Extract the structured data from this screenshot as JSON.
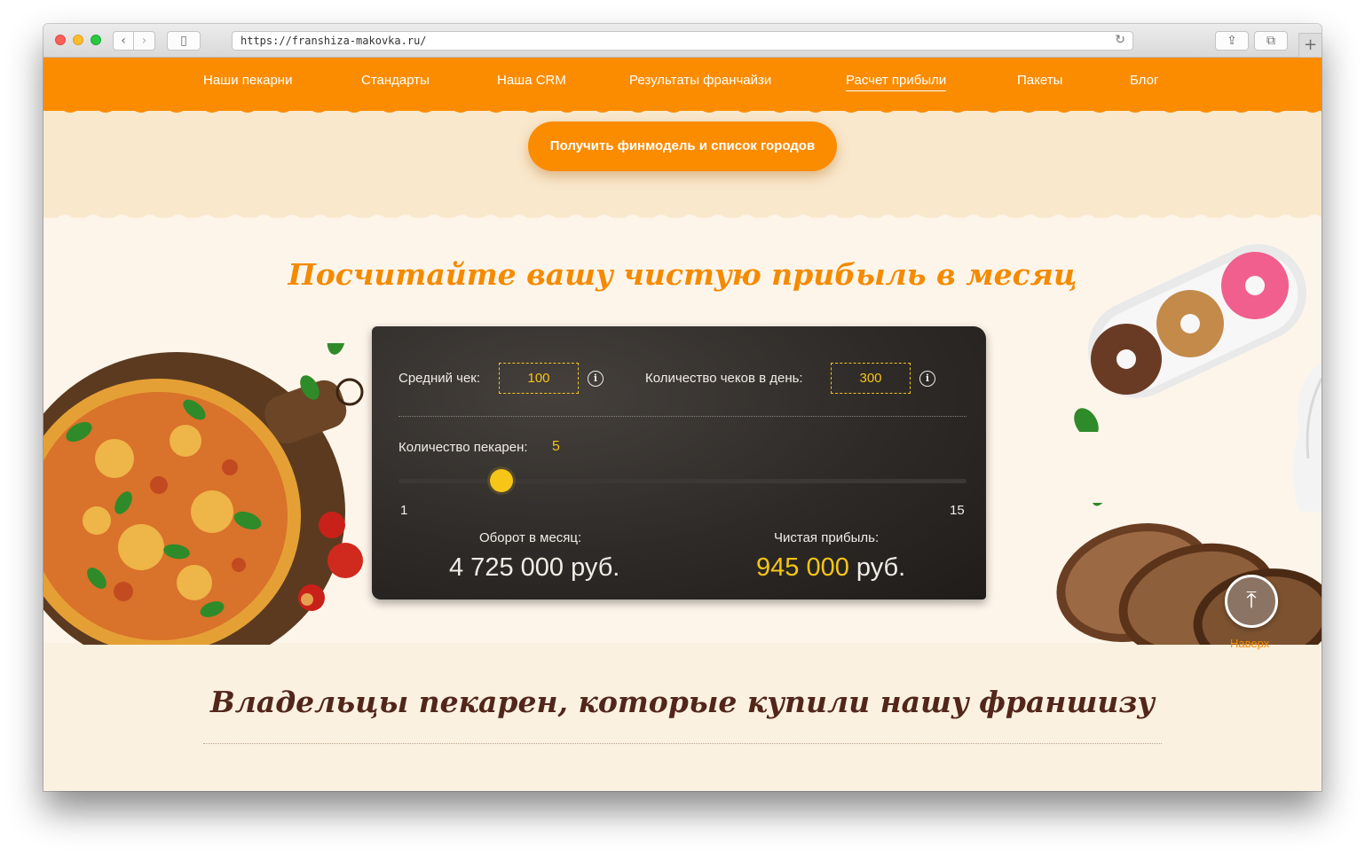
{
  "browser": {
    "url": "https://franshiza-makovka.ru/",
    "back_icon": "‹",
    "forward_icon": "›",
    "sidebar_icon": "▯",
    "share_icon": "⇪",
    "tabs_icon": "⧉",
    "newtab_icon": "+",
    "reload_icon": "↻"
  },
  "nav": {
    "items": [
      {
        "label": "Наши пекарни",
        "active": false
      },
      {
        "label": "Стандарты",
        "active": false
      },
      {
        "label": "Наша CRM",
        "active": false
      },
      {
        "label": "Результаты франчайзи",
        "active": false
      },
      {
        "label": "Расчет прибыли",
        "active": true
      },
      {
        "label": "Пакеты",
        "active": false
      },
      {
        "label": "Блог",
        "active": false
      }
    ]
  },
  "cta": {
    "label": "Получить финмодель и список городов"
  },
  "calculator": {
    "title": "Посчитайте вашу чистую прибыль в месяц",
    "avg_check_label": "Средний чек:",
    "avg_check_value": "100",
    "checks_per_day_label": "Количество чеков в день:",
    "checks_per_day_value": "300",
    "bakeries_label": "Количество пекарен:",
    "bakeries_value": "5",
    "slider_min": "1",
    "slider_max": "15",
    "slider_min_num": 1,
    "slider_max_num": 15,
    "slider_value_num": 5,
    "turnover_label": "Оборот в месяц:",
    "turnover_value": "4 725 000 руб.",
    "profit_label": "Чистая прибыль:",
    "profit_amount": "945 000",
    "profit_currency": " руб.",
    "info_icon": "i"
  },
  "scroll_top": {
    "icon": "⤒",
    "label": "Наверх"
  },
  "owners": {
    "title": "Владельцы пекарен, которые купили нашу франшизу"
  },
  "colors": {
    "brand_orange": "#fb8c00",
    "title_orange": "#f48a00",
    "accent_yellow": "#f5c518",
    "dark_brown": "#52261a"
  }
}
